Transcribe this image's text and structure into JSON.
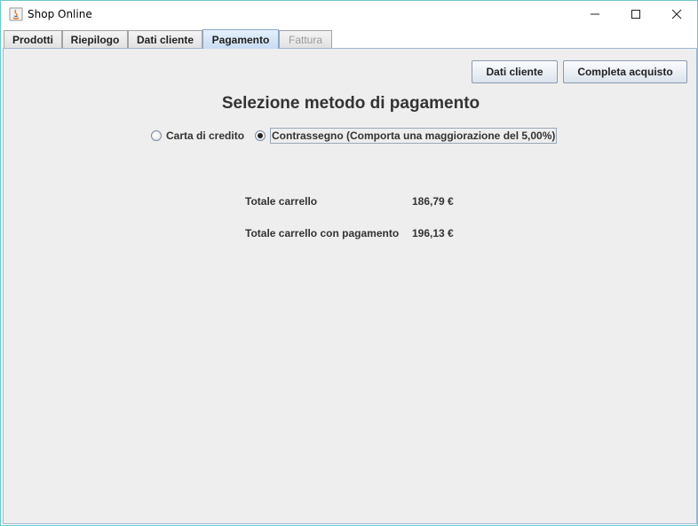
{
  "window": {
    "title": "Shop Online"
  },
  "tabs": [
    {
      "label": "Prodotti"
    },
    {
      "label": "Riepilogo"
    },
    {
      "label": "Dati cliente"
    },
    {
      "label": "Pagamento"
    },
    {
      "label": "Fattura"
    }
  ],
  "active_tab": "Pagamento",
  "disabled_tab": "Fattura",
  "buttons": {
    "dati_cliente": "Dati cliente",
    "completa_acquisto": "Completa acquisto"
  },
  "heading": "Selezione metodo di pagamento",
  "payment_options": [
    {
      "label": "Carta di credito",
      "selected": false
    },
    {
      "label": "Contrassegno (Comporta una maggiorazione del 5,00%)",
      "selected": true
    }
  ],
  "totals": [
    {
      "label": "Totale carrello",
      "value": "186,79 €"
    },
    {
      "label": "Totale carrello con pagamento",
      "value": "196,13 €"
    }
  ],
  "colors": {
    "panel_bg": "#eeeeee",
    "active_tab": "#c8dcf2",
    "window_border": "#6fc8c8"
  }
}
